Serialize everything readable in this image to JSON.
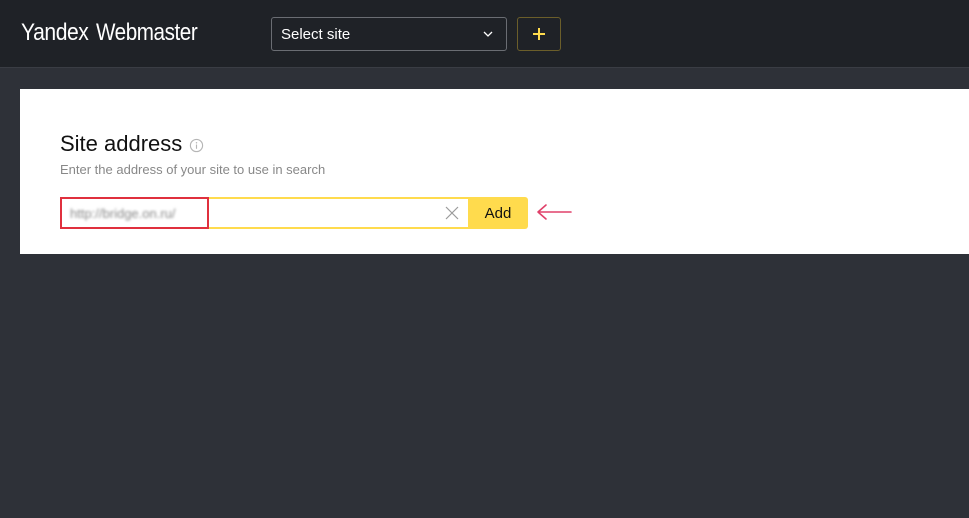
{
  "header": {
    "logo_brand": "Yandex",
    "logo_product": "Webmaster",
    "site_select_label": "Select site",
    "add_site_icon": "plus-icon"
  },
  "panel": {
    "title": "Site address",
    "info_icon": "info-icon",
    "subtitle": "Enter the address of your site to use in search",
    "url_input_value": "http://bridge.on.ru/",
    "clear_icon": "close-icon",
    "add_button_label": "Add"
  },
  "colors": {
    "topbar_bg": "#1f2227",
    "page_bg": "#2e3138",
    "accent_yellow": "#ffdb4d",
    "highlight_red": "#e0303e",
    "arrow_pink": "#e0406a"
  }
}
